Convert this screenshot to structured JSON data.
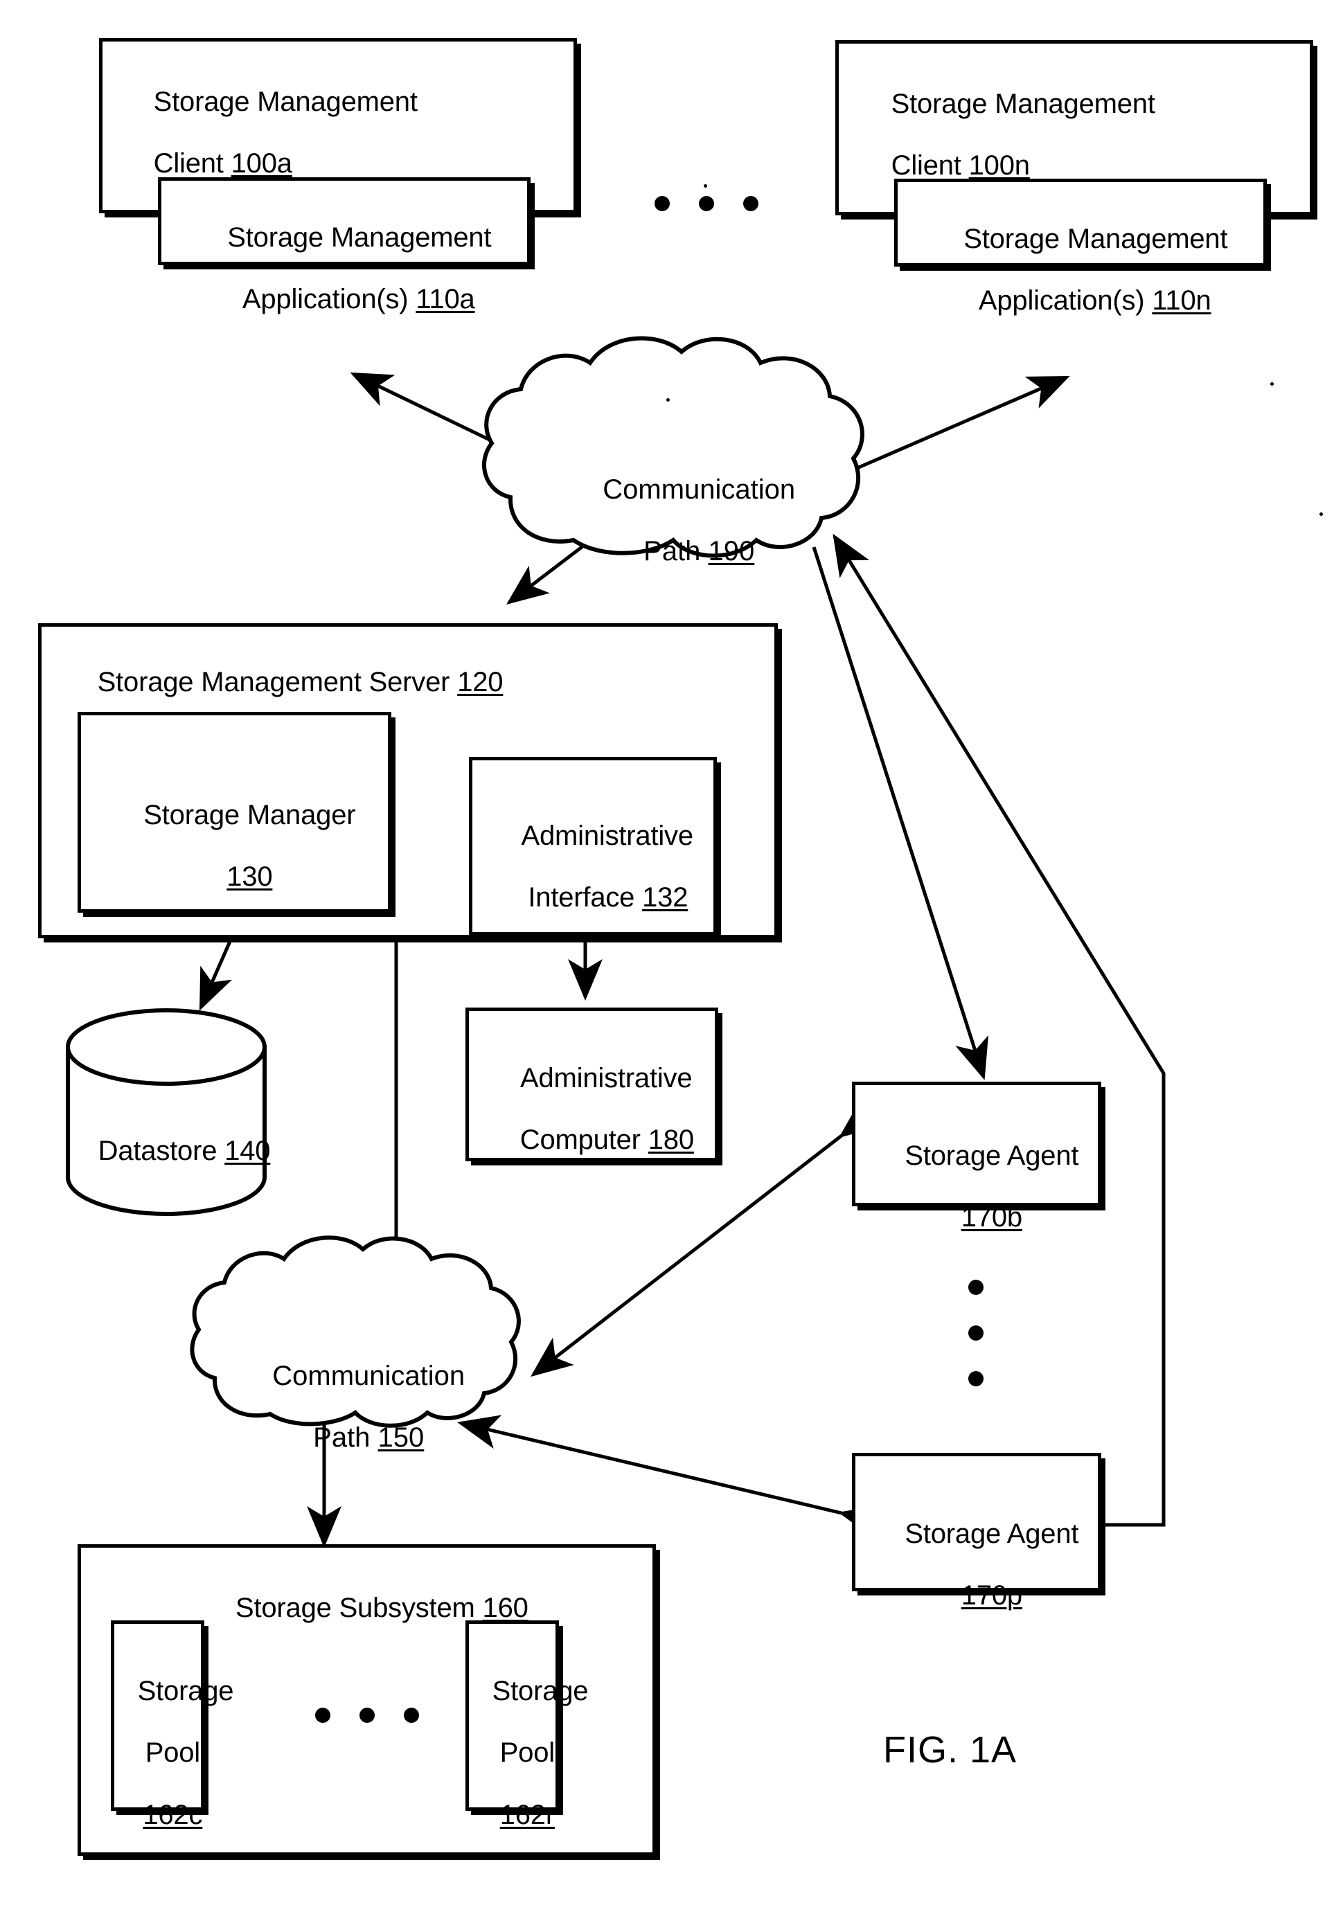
{
  "figure": {
    "label": "FIG. 1A"
  },
  "clients": [
    {
      "title_line1": "Storage Management",
      "title_line2": "Client ",
      "title_ref": "100a",
      "app": {
        "line1": "Storage Management",
        "line2": "Application(s) ",
        "ref": "110a"
      }
    },
    {
      "title_line1": "Storage Management",
      "title_line2": "Client ",
      "title_ref": "100n",
      "app": {
        "line1": "Storage Management",
        "line2": "Application(s) ",
        "ref": "110n"
      }
    }
  ],
  "clients_ellipsis": "• • •",
  "comm_path_190": {
    "line1": "Communication",
    "line2": "Path ",
    "ref": "190"
  },
  "comm_path_150": {
    "line1": "Communication",
    "line2": "Path ",
    "ref": "150"
  },
  "server": {
    "title": "Storage Management Server ",
    "title_ref": "120",
    "storage_manager": {
      "line1": "Storage Manager",
      "ref": "130"
    },
    "admin_interface": {
      "line1": "Administrative",
      "line2": "Interface ",
      "ref": "132"
    }
  },
  "datastore": {
    "label": "Datastore ",
    "ref": "140"
  },
  "admin_computer": {
    "line1": "Administrative",
    "line2": "Computer ",
    "ref": "180"
  },
  "storage_agents": [
    {
      "line1": "Storage Agent",
      "ref": "170b"
    },
    {
      "line1": "Storage Agent",
      "ref": "170p"
    }
  ],
  "agents_ellipsis": "• • • (vertical)",
  "subsystem": {
    "title": "Storage Subsystem ",
    "title_ref": "160",
    "pools": [
      {
        "line1": "Storage",
        "line2": "Pool",
        "ref": "162c"
      },
      {
        "line1": "Storage",
        "line2": "Pool",
        "ref": "162r"
      }
    ],
    "pools_ellipsis": "• • •"
  },
  "colors": {
    "ink": "#000000",
    "paper": "#ffffff"
  }
}
